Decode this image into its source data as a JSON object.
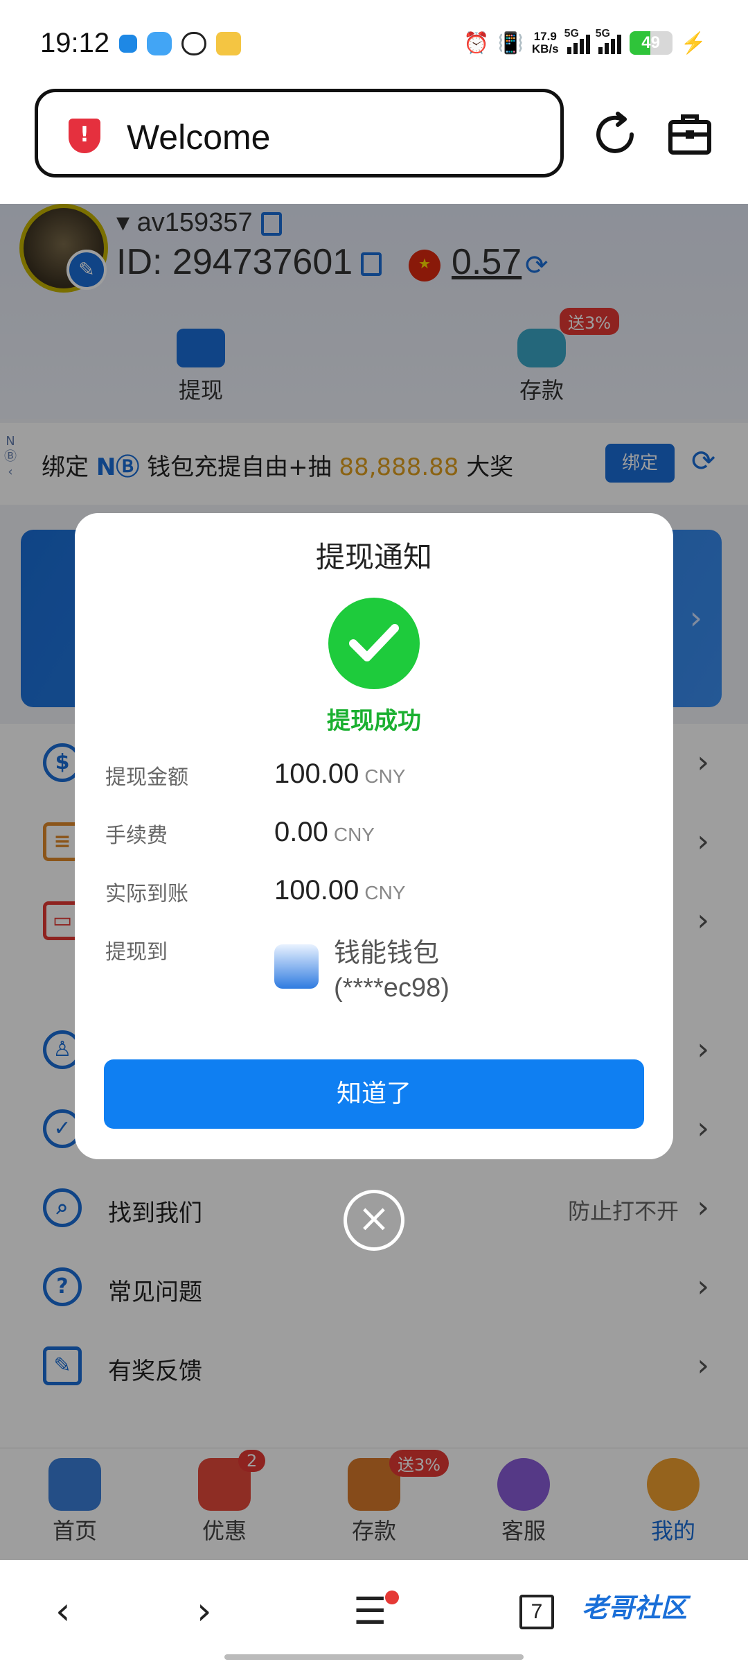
{
  "status_bar": {
    "time": "19:12",
    "speed": "17.9\nKB/s",
    "net1": "5G",
    "net2": "5G",
    "battery": "49"
  },
  "address_bar": {
    "title": "Welcome"
  },
  "profile": {
    "username": "av159357",
    "id": "ID: 294737601",
    "balance": "0.57",
    "actions": [
      {
        "label": "提现"
      },
      {
        "label": "存款",
        "badge": "送3%"
      }
    ]
  },
  "promo": {
    "prefix": "绑定 ",
    "brand": "NⒷ",
    "middle": " 钱包充提自由+抽 ",
    "amount": "88,888.88",
    "suffix": " 大奖",
    "button": "绑定",
    "side": "NⒷ"
  },
  "menu": {
    "items": [
      {
        "label": "找到我们",
        "right": "防止打不开"
      },
      {
        "label": "常见问题",
        "right": ""
      },
      {
        "label": "有奖反馈",
        "right": ""
      }
    ]
  },
  "tabbar": {
    "tabs": [
      {
        "label": "首页"
      },
      {
        "label": "优惠",
        "badge": "2"
      },
      {
        "label": "存款",
        "badge": "送3%"
      },
      {
        "label": "客服"
      },
      {
        "label": "我的"
      }
    ]
  },
  "modal": {
    "title": "提现通知",
    "status": "提现成功",
    "rows": [
      {
        "label": "提现金额",
        "value": "100.00",
        "currency": "CNY"
      },
      {
        "label": "手续费",
        "value": "0.00",
        "currency": "CNY"
      },
      {
        "label": "实际到账",
        "value": "100.00",
        "currency": "CNY"
      }
    ],
    "destination": {
      "label": "提现到",
      "wallet": "钱能钱包",
      "account": "(****ec98)"
    },
    "confirm": "知道了"
  },
  "browser_nav": {
    "tabs_count": "7",
    "watermark": "老哥社区"
  },
  "colors": {
    "accent": "#0f7ff2",
    "success": "#1ecb3c",
    "danger": "#e53935"
  }
}
